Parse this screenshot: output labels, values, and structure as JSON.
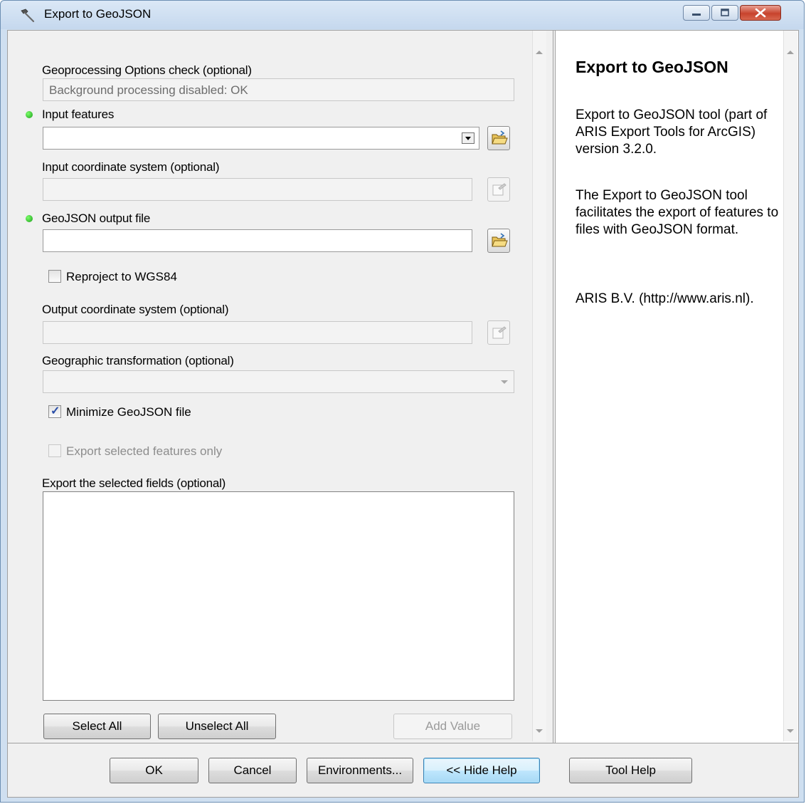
{
  "window": {
    "title": "Export to GeoJSON",
    "icon": "hammer-icon"
  },
  "params": {
    "gp_options_label": "Geoprocessing Options check (optional)",
    "gp_options_value": "Background processing disabled: OK",
    "input_features_label": "Input features",
    "input_features_value": "",
    "input_cs_label": "Input coordinate system (optional)",
    "input_cs_value": "",
    "output_file_label": "GeoJSON output file",
    "output_file_value": "",
    "reproject_label": "Reproject to WGS84",
    "reproject_checked": false,
    "output_cs_label": "Output coordinate system (optional)",
    "output_cs_value": "",
    "geo_transform_label": "Geographic transformation (optional)",
    "geo_transform_value": "",
    "minimize_label": "Minimize GeoJSON file",
    "minimize_checked": true,
    "export_selected_label": "Export selected features only",
    "export_selected_checked": false,
    "fields_label": "Export the selected fields (optional)",
    "fields_items": [],
    "select_all": "Select All",
    "unselect_all": "Unselect All",
    "add_value": "Add Value"
  },
  "help": {
    "title": "Export to GeoJSON",
    "paragraphs": [
      "Export to GeoJSON tool (part of ARIS Export Tools for ArcGIS) version 3.2.0.",
      "The Export to GeoJSON tool facilitates the export of features to files with GeoJSON format.",
      "ARIS B.V. (http://www.aris.nl)."
    ]
  },
  "footer": {
    "ok": "OK",
    "cancel": "Cancel",
    "environments": "Environments...",
    "hide_help": "<< Hide Help",
    "tool_help": "Tool Help"
  },
  "colors": {
    "required_dot": "#1a9d1a",
    "focus_button": "#3c7fb1",
    "close_button": "#c7432d"
  }
}
